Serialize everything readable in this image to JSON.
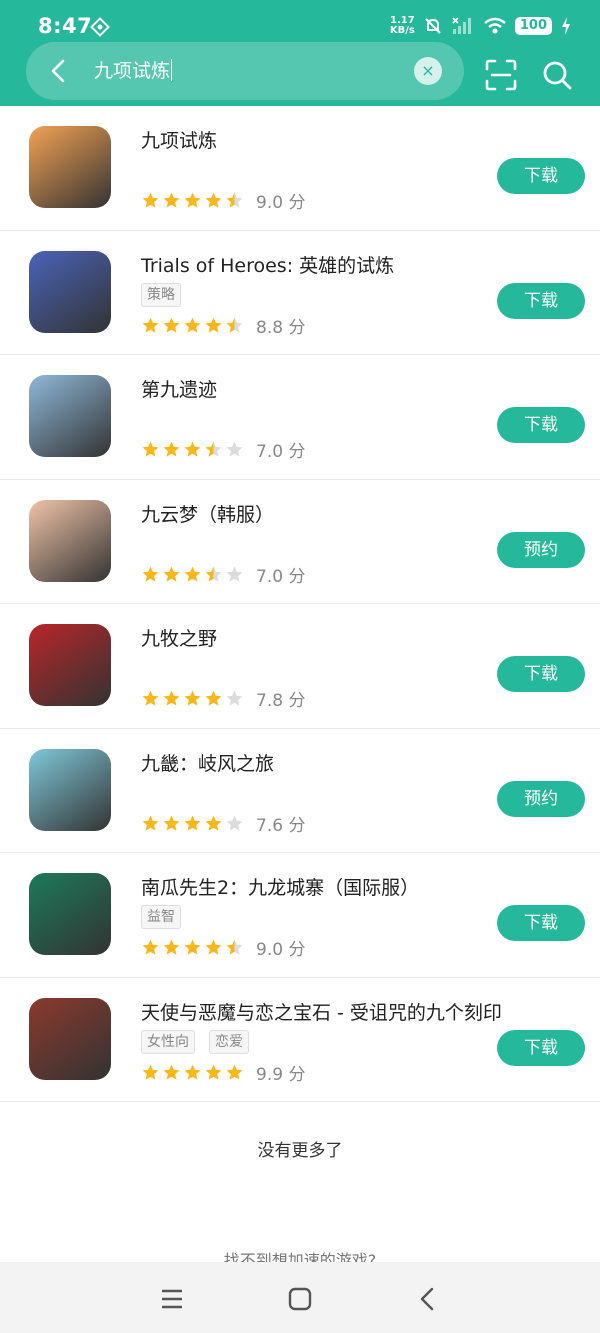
{
  "status": {
    "time": "8:47",
    "speed_value": "1.17",
    "speed_unit": "KB/s",
    "battery": "100"
  },
  "search": {
    "query": "九项试炼",
    "clear_label": "×"
  },
  "apps": [
    {
      "title": "九项试炼",
      "tags": [],
      "rating": 4.5,
      "score": "9.0 分",
      "action": "下载",
      "icon_color": "#f3a255"
    },
    {
      "title": "Trials of Heroes: 英雄的试炼",
      "tags": [
        "策略"
      ],
      "rating": 4.5,
      "score": "8.8 分",
      "action": "下载",
      "icon_color": "#4a63b8"
    },
    {
      "title": "第九遗迹",
      "tags": [],
      "rating": 3.5,
      "score": "7.0 分",
      "action": "下载",
      "icon_color": "#8fb8d8"
    },
    {
      "title": "九云梦（韩服）",
      "tags": [],
      "rating": 3.5,
      "score": "7.0 分",
      "action": "预约",
      "icon_color": "#f0c4a8"
    },
    {
      "title": "九牧之野",
      "tags": [],
      "rating": 4,
      "score": "7.8 分",
      "action": "下载",
      "icon_color": "#b8262a"
    },
    {
      "title": "九畿：岐风之旅",
      "tags": [],
      "rating": 4,
      "score": "7.6 分",
      "action": "预约",
      "icon_color": "#7fc8d8"
    },
    {
      "title": "南瓜先生2：九龙城寨（国际服）",
      "tags": [
        "益智"
      ],
      "rating": 4.5,
      "score": "9.0 分",
      "action": "下载",
      "icon_color": "#1d7a5a"
    },
    {
      "title": "天使与恶魔与恋之宝石 - 受诅咒的九个刻印",
      "tags": [
        "女性向",
        "恋爱"
      ],
      "rating": 5,
      "score": "9.9 分",
      "action": "下载",
      "icon_color": "#8a3a2e"
    }
  ],
  "footer": {
    "no_more": "没有更多了",
    "cant_find": "找不到想加速的游戏?"
  },
  "colors": {
    "accent": "#26b89a",
    "star_on": "#f9b71a",
    "star_off": "#dcdcdc"
  }
}
